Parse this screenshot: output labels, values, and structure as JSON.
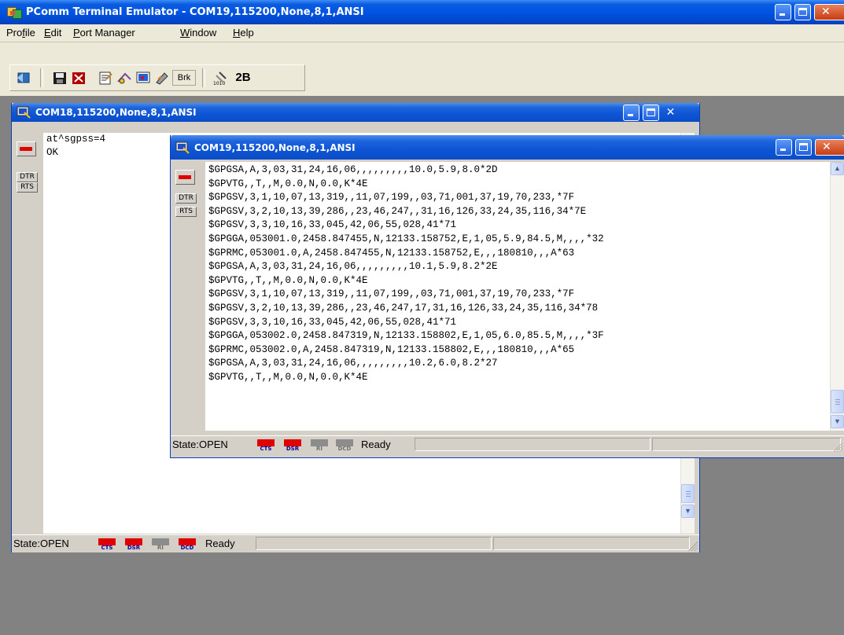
{
  "app": {
    "title": "PComm Terminal Emulator - COM19,115200,None,8,1,ANSI"
  },
  "menu": {
    "items": [
      {
        "pre": "Pro",
        "key": "f",
        "post": "ile"
      },
      {
        "pre": "",
        "key": "E",
        "post": "dit"
      },
      {
        "pre": "",
        "key": "P",
        "post": "ort Manager"
      },
      {
        "pre": "",
        "key": "W",
        "post": "indow"
      },
      {
        "pre": "",
        "key": "H",
        "post": "elp"
      }
    ]
  },
  "toolbar": {
    "break_label": "Brk",
    "twob_label": "2B"
  },
  "com18": {
    "title": "COM18,115200,None,8,1,ANSI",
    "dtr": "DTR",
    "rts": "RTS",
    "lines": [
      "at^sgpss=4",
      "OK"
    ],
    "status": {
      "state": "State:OPEN",
      "cts": "CTS",
      "dsr": "DSR",
      "ri": "RI",
      "dcd": "DCD",
      "ready": "Ready"
    }
  },
  "com19": {
    "title": "COM19,115200,None,8,1,ANSI",
    "dtr": "DTR",
    "rts": "RTS",
    "lines": [
      "$GPGSA,A,3,03,31,24,16,06,,,,,,,,,10.0,5.9,8.0*2D",
      "$GPVTG,,T,,M,0.0,N,0.0,K*4E",
      "$GPGSV,3,1,10,07,13,319,,11,07,199,,03,71,001,37,19,70,233,*7F",
      "$GPGSV,3,2,10,13,39,286,,23,46,247,,31,16,126,33,24,35,116,34*7E",
      "$GPGSV,3,3,10,16,33,045,42,06,55,028,41*71",
      "$GPGGA,053001.0,2458.847455,N,12133.158752,E,1,05,5.9,84.5,M,,,,*32",
      "$GPRMC,053001.0,A,2458.847455,N,12133.158752,E,,,180810,,,A*63",
      "$GPGSA,A,3,03,31,24,16,06,,,,,,,,,10.1,5.9,8.2*2E",
      "$GPVTG,,T,,M,0.0,N,0.0,K*4E",
      "$GPGSV,3,1,10,07,13,319,,11,07,199,,03,71,001,37,19,70,233,*7F",
      "$GPGSV,3,2,10,13,39,286,,23,46,247,17,31,16,126,33,24,35,116,34*78",
      "$GPGSV,3,3,10,16,33,045,42,06,55,028,41*71",
      "$GPGGA,053002.0,2458.847319,N,12133.158802,E,1,05,6.0,85.5,M,,,,*3F",
      "$GPRMC,053002.0,A,2458.847319,N,12133.158802,E,,,180810,,,A*65",
      "$GPGSA,A,3,03,31,24,16,06,,,,,,,,,10.2,6.0,8.2*27",
      "$GPVTG,,T,,M,0.0,N,0.0,K*4E"
    ],
    "status": {
      "state": "State:OPEN",
      "cts": "CTS",
      "dsr": "DSR",
      "ri": "RI",
      "dcd": "DCD",
      "ready": "Ready"
    }
  },
  "colors": {
    "led_active": "#e00000",
    "led_inactive": "#8c8c8c",
    "mdi_background": "#828282"
  }
}
